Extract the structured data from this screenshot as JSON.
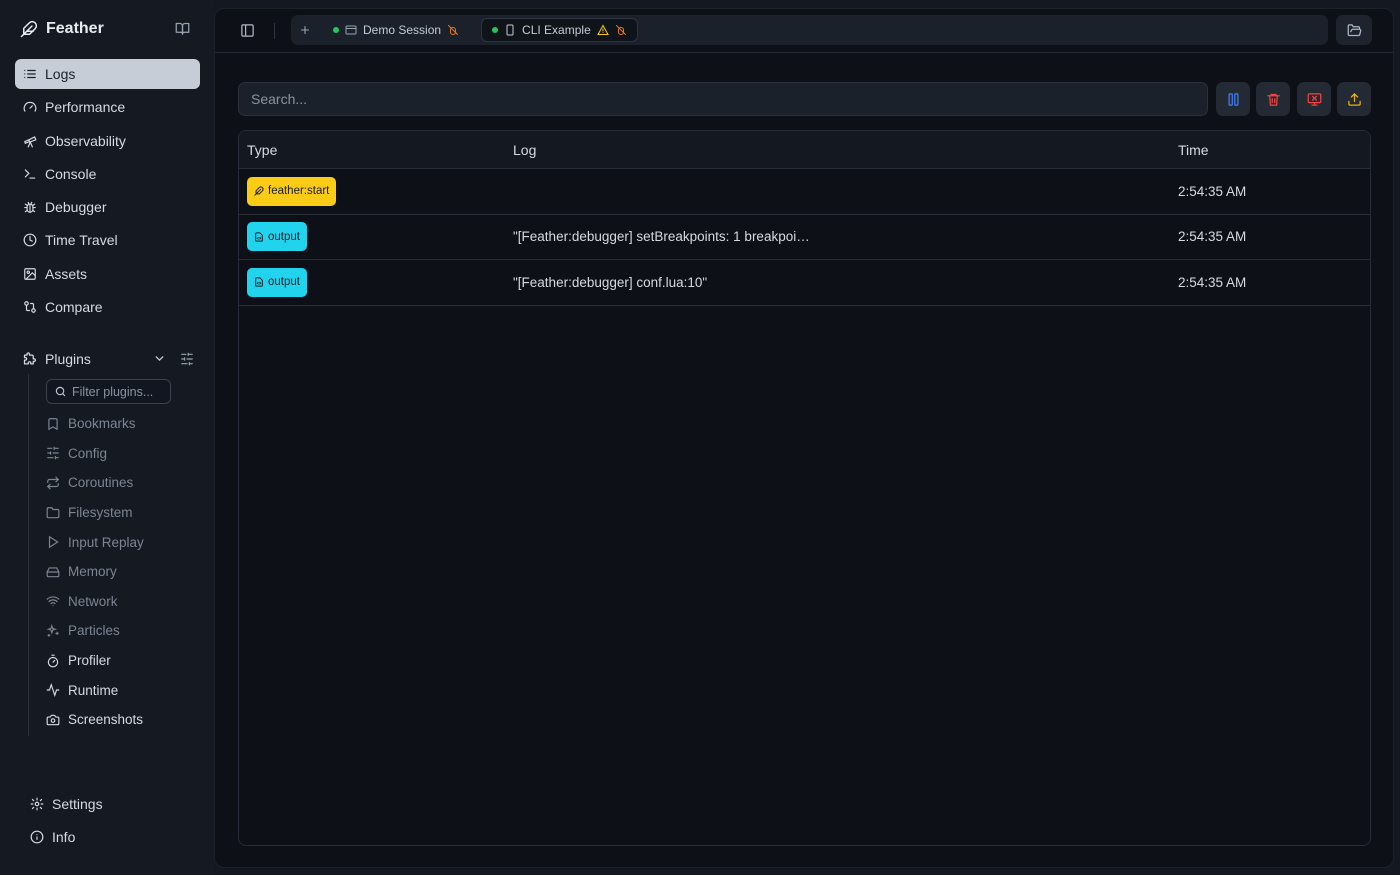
{
  "app": {
    "name": "Feather"
  },
  "sidebar": {
    "nav": [
      {
        "label": "Logs",
        "icon": "list-icon",
        "active": true
      },
      {
        "label": "Performance",
        "icon": "gauge-icon"
      },
      {
        "label": "Observability",
        "icon": "telescope-icon"
      },
      {
        "label": "Console",
        "icon": "terminal-icon"
      },
      {
        "label": "Debugger",
        "icon": "bug-icon"
      },
      {
        "label": "Time Travel",
        "icon": "clock-icon"
      },
      {
        "label": "Assets",
        "icon": "image-icon"
      },
      {
        "label": "Compare",
        "icon": "compare-icon"
      }
    ],
    "plugins_label": "Plugins",
    "filter_placeholder": "Filter plugins...",
    "plugins": [
      {
        "label": "Bookmarks",
        "icon": "bookmark-icon",
        "enabled": false
      },
      {
        "label": "Config",
        "icon": "sliders-icon",
        "enabled": false
      },
      {
        "label": "Coroutines",
        "icon": "repeat-icon",
        "enabled": false
      },
      {
        "label": "Filesystem",
        "icon": "folder-icon",
        "enabled": false
      },
      {
        "label": "Input Replay",
        "icon": "play-icon",
        "enabled": false
      },
      {
        "label": "Memory",
        "icon": "hard-drive-icon",
        "enabled": false
      },
      {
        "label": "Network",
        "icon": "wifi-icon",
        "enabled": false
      },
      {
        "label": "Particles",
        "icon": "sparkles-icon",
        "enabled": false
      },
      {
        "label": "Profiler",
        "icon": "timer-icon",
        "enabled": true
      },
      {
        "label": "Runtime",
        "icon": "activity-icon",
        "enabled": true
      },
      {
        "label": "Screenshots",
        "icon": "camera-icon",
        "enabled": true
      }
    ],
    "footer": [
      {
        "label": "Settings",
        "icon": "gear-icon"
      },
      {
        "label": "Info",
        "icon": "info-icon"
      }
    ]
  },
  "tabs": [
    {
      "label": "Demo Session",
      "status_color": "#22c55e",
      "active": false
    },
    {
      "label": "CLI Example",
      "status_color": "#22c55e",
      "active": true
    }
  ],
  "search": {
    "placeholder": "Search..."
  },
  "toolbar": {
    "colors": {
      "columns": "#3b82f6",
      "clear": "#ef4444",
      "disconnect": "#ef4444",
      "export": "#eab308"
    }
  },
  "table": {
    "headers": {
      "type": "Type",
      "log": "Log",
      "time": "Time"
    },
    "rows": [
      {
        "type": "feather:start",
        "log": "",
        "time": "2:54:35 AM"
      },
      {
        "type": "output",
        "log": "\"[Feather:debugger] setBreakpoints: 1 breakpoi…",
        "time": "2:54:35 AM"
      },
      {
        "type": "output",
        "log": "\"[Feather:debugger] conf.lua:10\"",
        "time": "2:54:35 AM"
      }
    ]
  }
}
